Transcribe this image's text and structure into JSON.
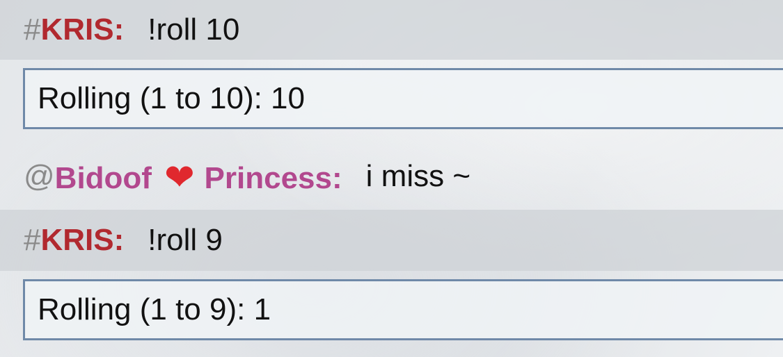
{
  "messages": [
    {
      "type": "chat",
      "prefix": "#",
      "user": "KRIS",
      "separator": ":",
      "text": "!roll 10",
      "user_color": "#b1292f",
      "highlighted": true
    },
    {
      "type": "roll_result",
      "text": "Rolling (1 to 10): 10"
    },
    {
      "type": "chat",
      "prefix": "@",
      "user": "Bidoof",
      "icon": "heart-icon",
      "icon_glyph": "❤",
      "user_suffix": "Princess",
      "separator": ":",
      "text": "i miss ~",
      "user_color": "#b2488e",
      "highlighted": false
    },
    {
      "type": "chat",
      "prefix": "#",
      "user": "KRIS",
      "separator": ":",
      "text": "!roll 9",
      "user_color": "#b1292f",
      "highlighted": true
    },
    {
      "type": "roll_result",
      "text": "Rolling (1 to 9): 1"
    }
  ]
}
